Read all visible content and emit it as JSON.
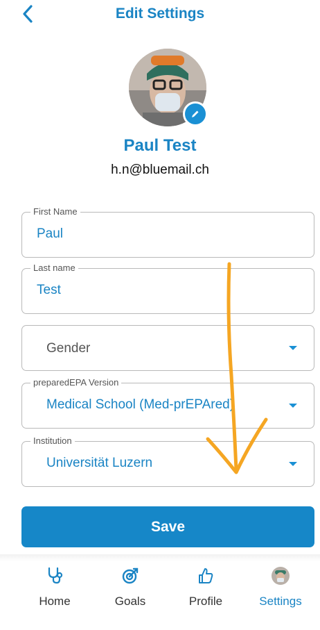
{
  "header": {
    "title": "Edit Settings",
    "back_icon": "chevron-left-icon"
  },
  "profile": {
    "name": "Paul Test",
    "email": "h.n@bluemail.ch",
    "edit_icon": "pencil-icon"
  },
  "form": {
    "first_name": {
      "label": "First Name",
      "value": "Paul"
    },
    "last_name": {
      "label": "Last name",
      "value": "Test"
    },
    "gender": {
      "placeholder": "Gender"
    },
    "version": {
      "label": "preparedEPA Version",
      "value": "Medical School (Med-prEPAred)"
    },
    "institution": {
      "label": "Institution",
      "value": "Universität Luzern"
    }
  },
  "save_label": "Save",
  "nav": {
    "items": [
      {
        "label": "Home",
        "icon": "stethoscope-icon"
      },
      {
        "label": "Goals",
        "icon": "target-icon"
      },
      {
        "label": "Profile",
        "icon": "thumbs-up-icon"
      },
      {
        "label": "Settings",
        "icon": "avatar-icon"
      }
    ],
    "active": "Settings"
  },
  "colors": {
    "accent": "#1a84c4",
    "button": "#1687c8",
    "annotation": "#f5a623"
  }
}
